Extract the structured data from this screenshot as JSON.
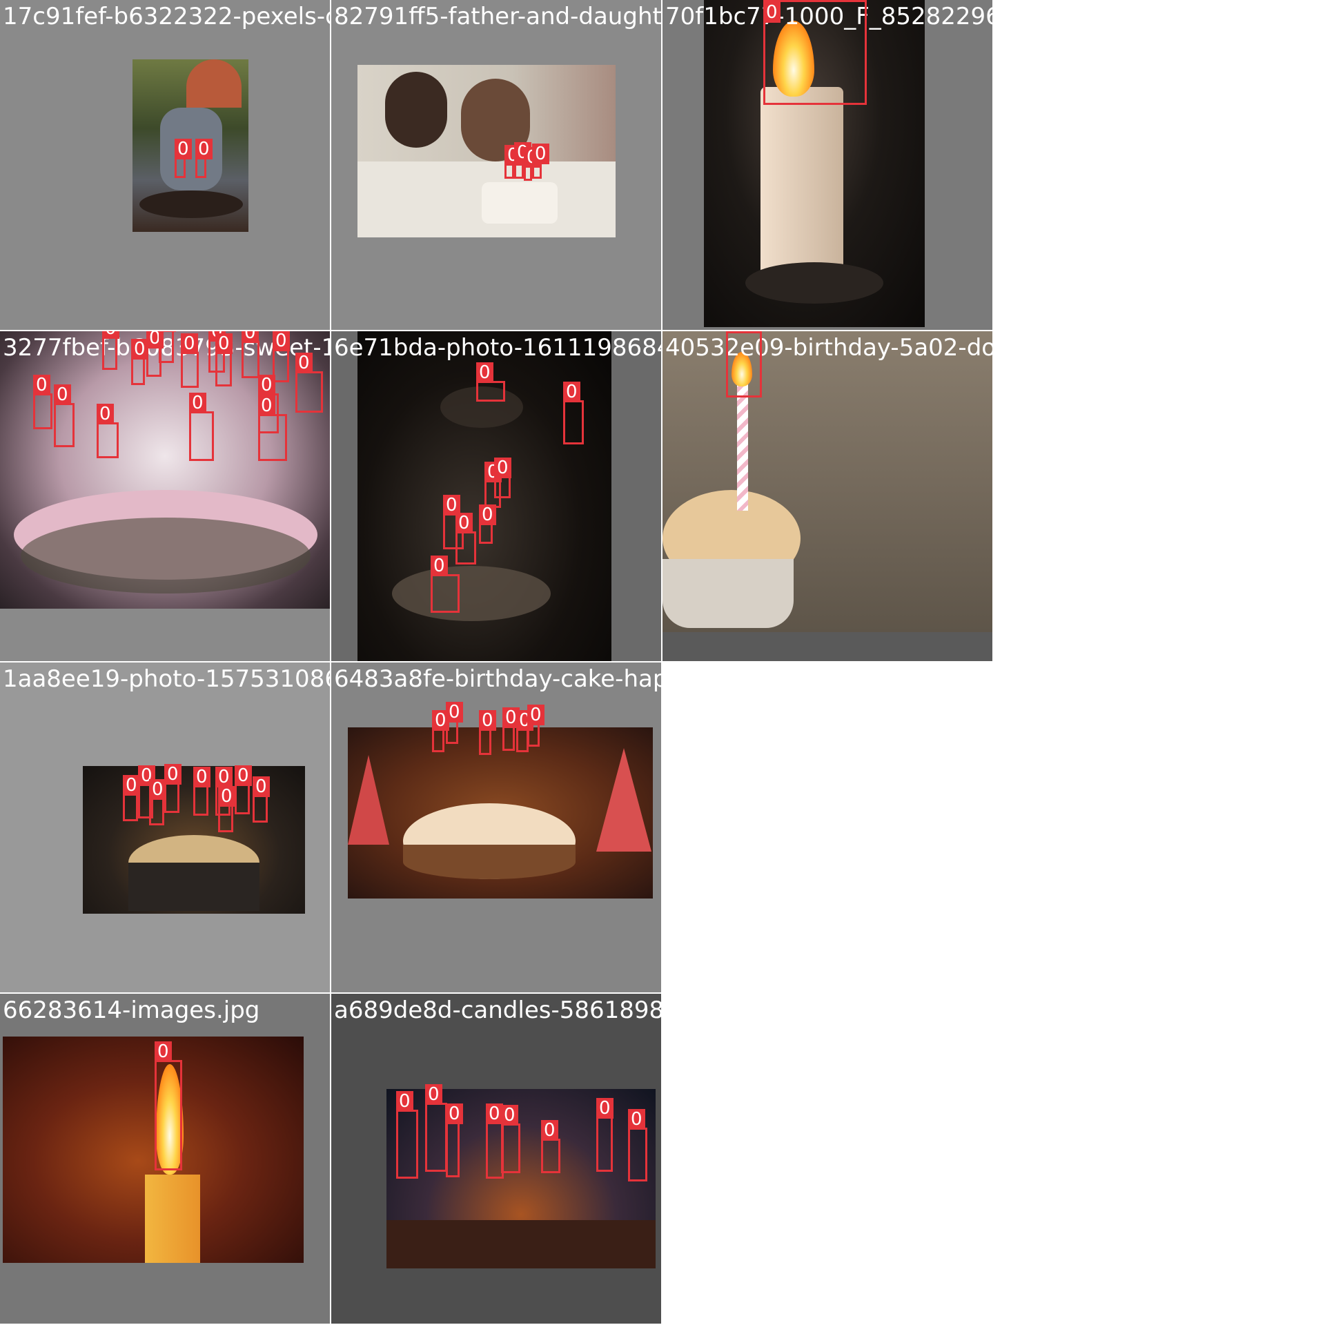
{
  "tiles": [
    {
      "id": "t1",
      "filename": "17c91fef-b6322322-pexels-cottonbro-4489733.jpg",
      "cls": "0"
    },
    {
      "id": "t2",
      "filename": "82791ff5-father-and-daughter-birthday.jpg",
      "cls": "0"
    },
    {
      "id": "t3",
      "filename": "70f1bc77-1000_F_85282296_cTtatGr03ya90k4",
      "cls": "0"
    },
    {
      "id": "t4",
      "filename": "3277fbef-b6083793-sweet-16-birthday-cake",
      "cls": "0"
    },
    {
      "id": "t5",
      "filename": "6e71bda-photo-1611198684653-60953c8cc4f2",
      "cls": "0"
    },
    {
      "id": "t6",
      "filename": "40532e09-birthday-5a02-donut-g5cb71a89f_1280.",
      "cls": "0"
    },
    {
      "id": "t7",
      "filename": "1aa8ee19-photo-1575310866442-78f8cb5811c9",
      "cls": "0"
    },
    {
      "id": "t8",
      "filename": "6483a8fe-birthday-cake-happy-birthday-celebra",
      "cls": "0"
    },
    {
      "id": "t9",
      "filename": "66283614-images.jpg",
      "cls": "0"
    },
    {
      "id": "t10",
      "filename": "a689de8d-candles-5861898_960_720.jpg",
      "cls": "0"
    }
  ],
  "class_label": "0"
}
